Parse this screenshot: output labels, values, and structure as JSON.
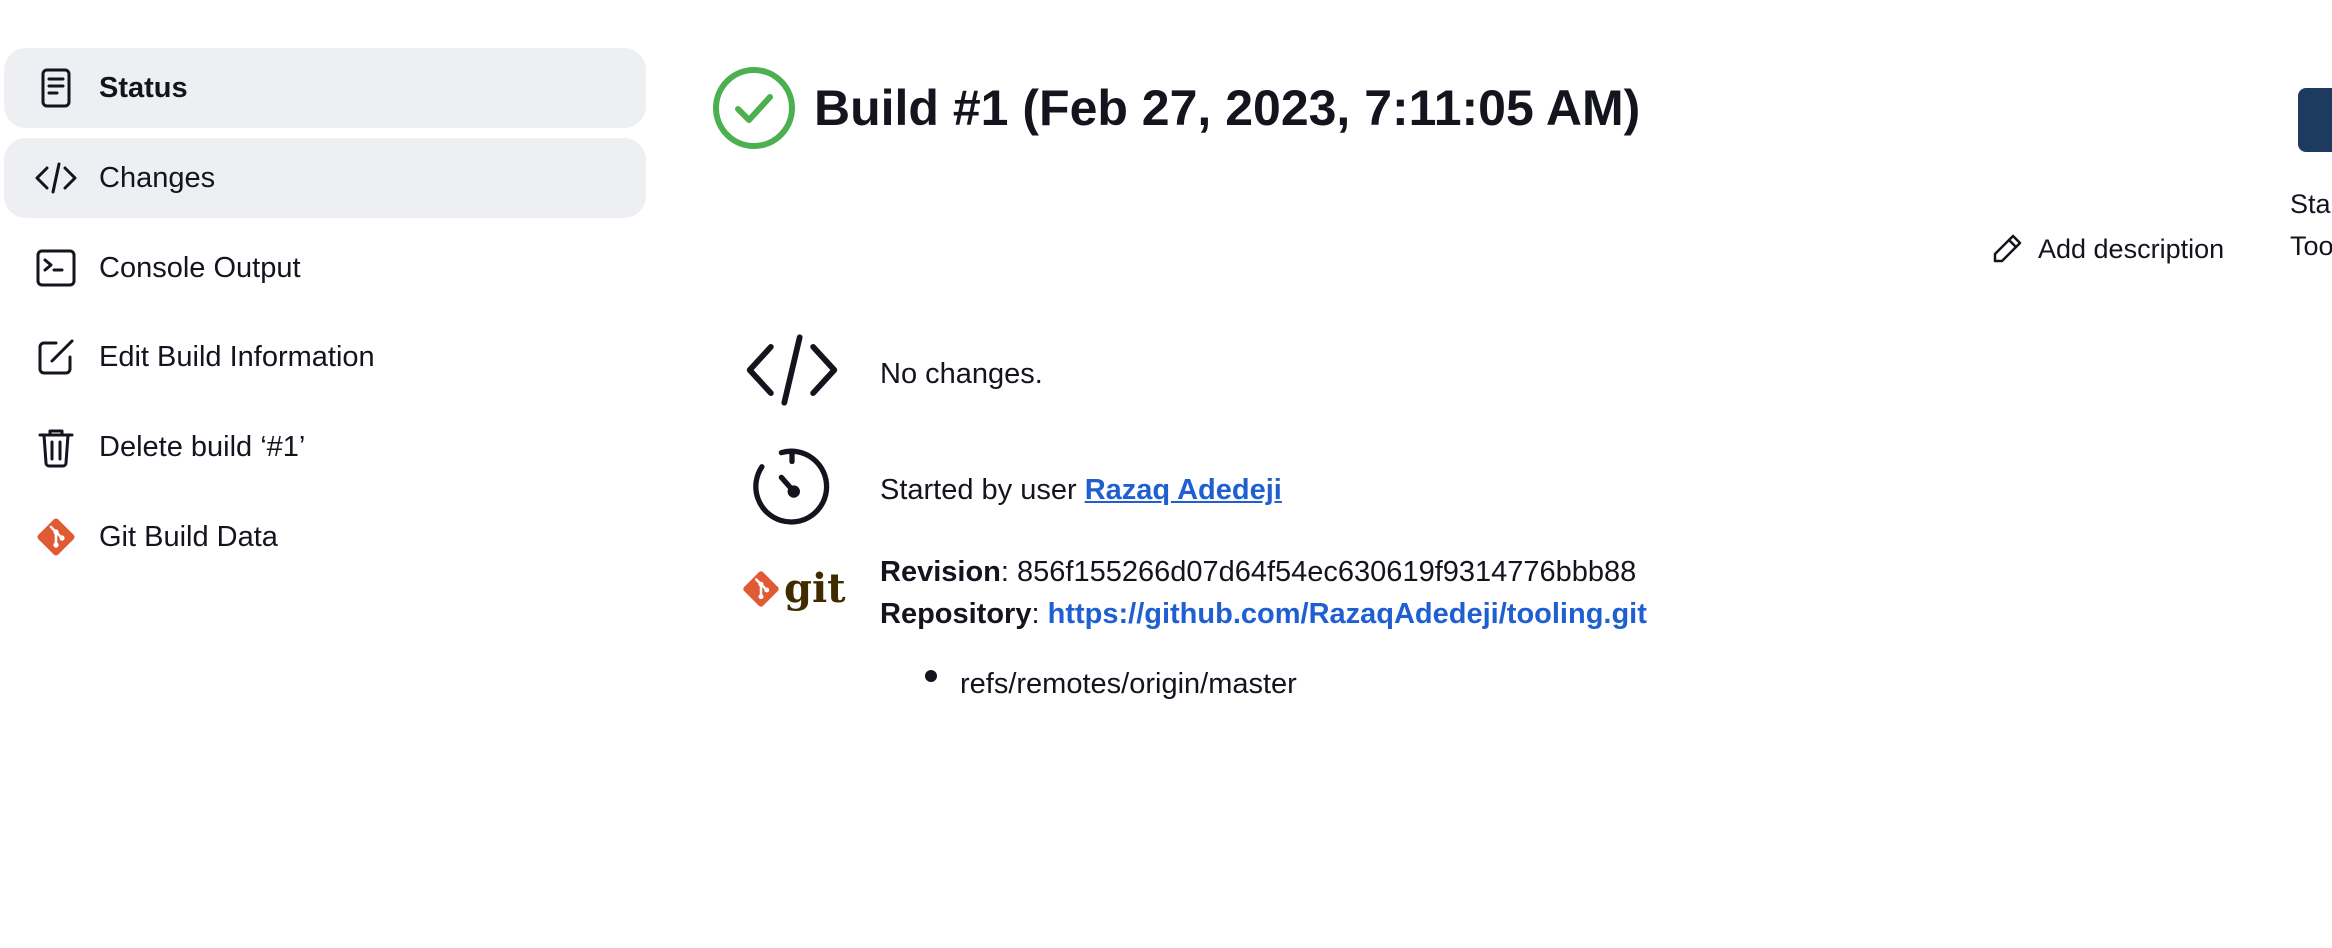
{
  "sidebar": {
    "items": [
      {
        "label": "Status",
        "icon": "document-icon"
      },
      {
        "label": "Changes",
        "icon": "code-icon"
      },
      {
        "label": "Console Output",
        "icon": "terminal-icon"
      },
      {
        "label": "Edit Build Information",
        "icon": "edit-icon"
      },
      {
        "label": "Delete build ‘#1’",
        "icon": "trash-icon"
      },
      {
        "label": "Git Build Data",
        "icon": "git-icon"
      }
    ]
  },
  "header": {
    "title": "Build #1 (Feb 27, 2023, 7:11:05 AM)",
    "status_icon": "success-check-icon",
    "add_description_label": "Add description"
  },
  "right_panel": {
    "line1": "Sta",
    "line2": "Too"
  },
  "changes": {
    "text": "No changes."
  },
  "cause": {
    "prefix": "Started by user ",
    "user": "Razaq Adedeji"
  },
  "git": {
    "logo_text": "git",
    "revision_label": "Revision",
    "revision_value": "856f155266d07d64f54ec630619f9314776bbb88",
    "repository_label": "Repository",
    "repository_url": "https://github.com/RazaqAdedeji/tooling.git",
    "branches": [
      "refs/remotes/origin/master"
    ]
  },
  "colors": {
    "success": "#4caf50",
    "link": "#1f5fd1",
    "git_orange": "#e05a33",
    "highlight": "#eeeff3"
  }
}
